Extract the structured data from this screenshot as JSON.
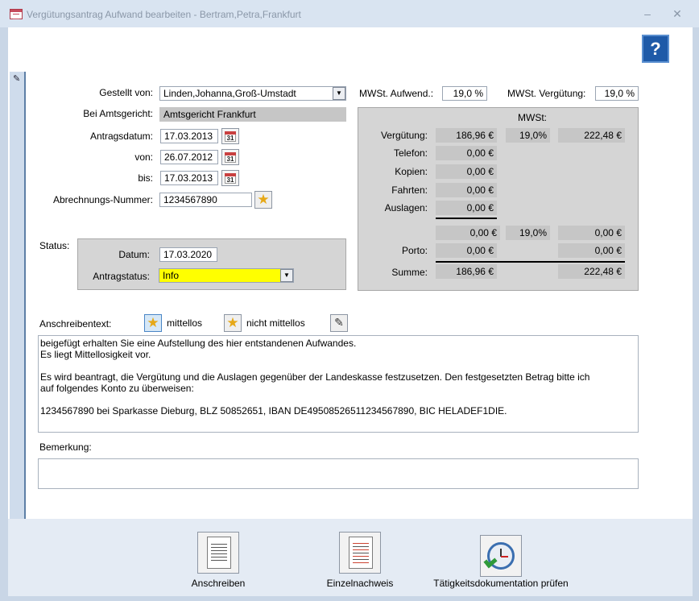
{
  "window": {
    "title": "Vergütungsantrag Aufwand bearbeiten - Bertram,Petra,Frankfurt",
    "help_label": "?"
  },
  "form": {
    "gestellt_von": {
      "label": "Gestellt von:",
      "value": "Linden,Johanna,Groß-Umstadt"
    },
    "amtsgericht": {
      "label": "Bei Amtsgericht:",
      "value": "Amtsgericht Frankfurt"
    },
    "antragsdatum": {
      "label": "Antragsdatum:",
      "value": "17.03.2013"
    },
    "von": {
      "label": "von:",
      "value": "26.07.2012"
    },
    "bis": {
      "label": "bis:",
      "value": "17.03.2013"
    },
    "abrechnungs_nummer": {
      "label": "Abrechnungs-Nummer:",
      "value": "1234567890"
    },
    "calendar_icon_text": "31"
  },
  "mwst": {
    "aufwend_label": "MWSt. Aufwend.:",
    "aufwend_value": "19,0 %",
    "verguetung_label": "MWSt. Vergütung:",
    "verguetung_value": "19,0 %",
    "header": "MWSt:",
    "rows": {
      "verguetung": {
        "label": "Vergütung:",
        "value": "186,96 €",
        "rate": "19,0%",
        "total": "222,48 €"
      },
      "telefon": {
        "label": "Telefon:",
        "value": "0,00 €"
      },
      "kopien": {
        "label": "Kopien:",
        "value": "0,00 €"
      },
      "fahrten": {
        "label": "Fahrten:",
        "value": "0,00 €"
      },
      "auslagen": {
        "label": "Auslagen:",
        "value": "0,00 €"
      },
      "zwischen": {
        "value": "0,00 €",
        "rate": "19,0%",
        "total": "0,00 €"
      },
      "porto": {
        "label": "Porto:",
        "value": "0,00 €",
        "total": "0,00 €"
      },
      "summe": {
        "label": "Summe:",
        "value": "186,96 €",
        "total": "222,48 €"
      }
    }
  },
  "status": {
    "label": "Status:",
    "datum_label": "Datum:",
    "datum_value": "17.03.2020",
    "antragstatus_label": "Antragstatus:",
    "antragstatus_value": "Info"
  },
  "anschreiben": {
    "label": "Anschreibentext:",
    "mittellos_label": "mittellos",
    "nicht_mittellos_label": "nicht mittellos",
    "lines": [
      "beigefügt erhalten Sie eine Aufstellung des hier entstandenen Aufwandes.",
      "Es liegt Mittellosigkeit vor.",
      "",
      "Es wird beantragt, die Vergütung und die Auslagen gegenüber der Landeskasse festzusetzen. Den festgesetzten Betrag bitte ich",
      "auf folgendes Konto zu überweisen:",
      "",
      "1234567890 bei Sparkasse Dieburg, BLZ 50852651, IBAN DE49508526511234567890, BIC HELADEF1DIE."
    ]
  },
  "bemerkung": {
    "label": "Bemerkung:",
    "value": ""
  },
  "footer": {
    "anschreiben_label": "Anschreiben",
    "einzelnachweis_label": "Einzelnachweis",
    "taetigkeit_label": "Tätigkeitsdokumentation prüfen"
  },
  "icons": [
    "app-form-icon",
    "minimize-icon",
    "close-icon",
    "help-icon",
    "pencil-icon",
    "calendar-icon",
    "star-icon",
    "edit-pen-icon",
    "document-icon",
    "report-icon",
    "clock-check-icon"
  ],
  "colors": {
    "antragstatus_bg": "#ffff00",
    "help_bg": "#1e5aa8"
  }
}
